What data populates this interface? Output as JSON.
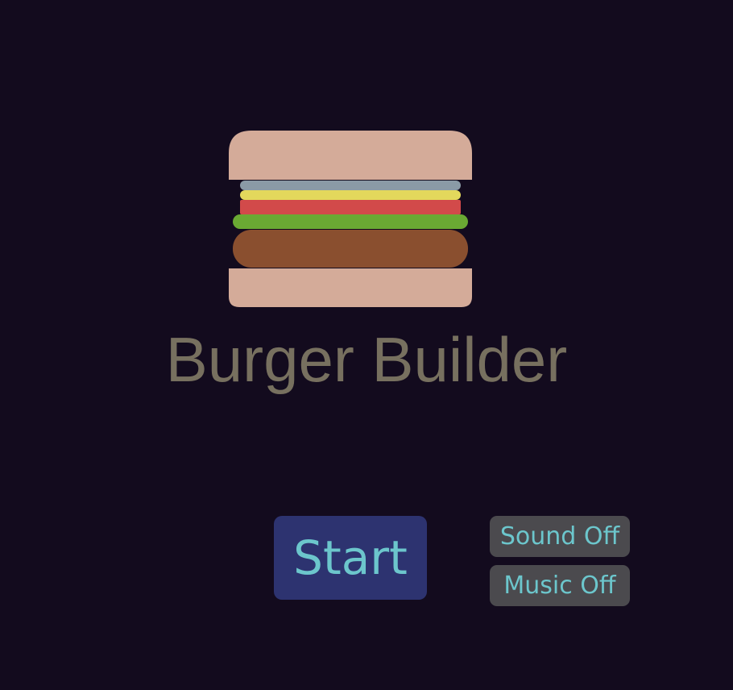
{
  "game": {
    "title": "Burger Builder"
  },
  "menu": {
    "start_label": "Start",
    "sound_label": "Sound Off",
    "music_label": "Music Off"
  },
  "colors": {
    "background": "#130b1e",
    "bun": "#d4ab99",
    "plate": "#8a9aa6",
    "cheese": "#e3d85c",
    "tomato": "#d24a4a",
    "lettuce": "#6aa933",
    "patty": "#8a4f2f",
    "title": "#77705f",
    "start_button": "#2d3370",
    "toggle_button": "#4b4a4e",
    "button_text": "#6cc6cc"
  }
}
